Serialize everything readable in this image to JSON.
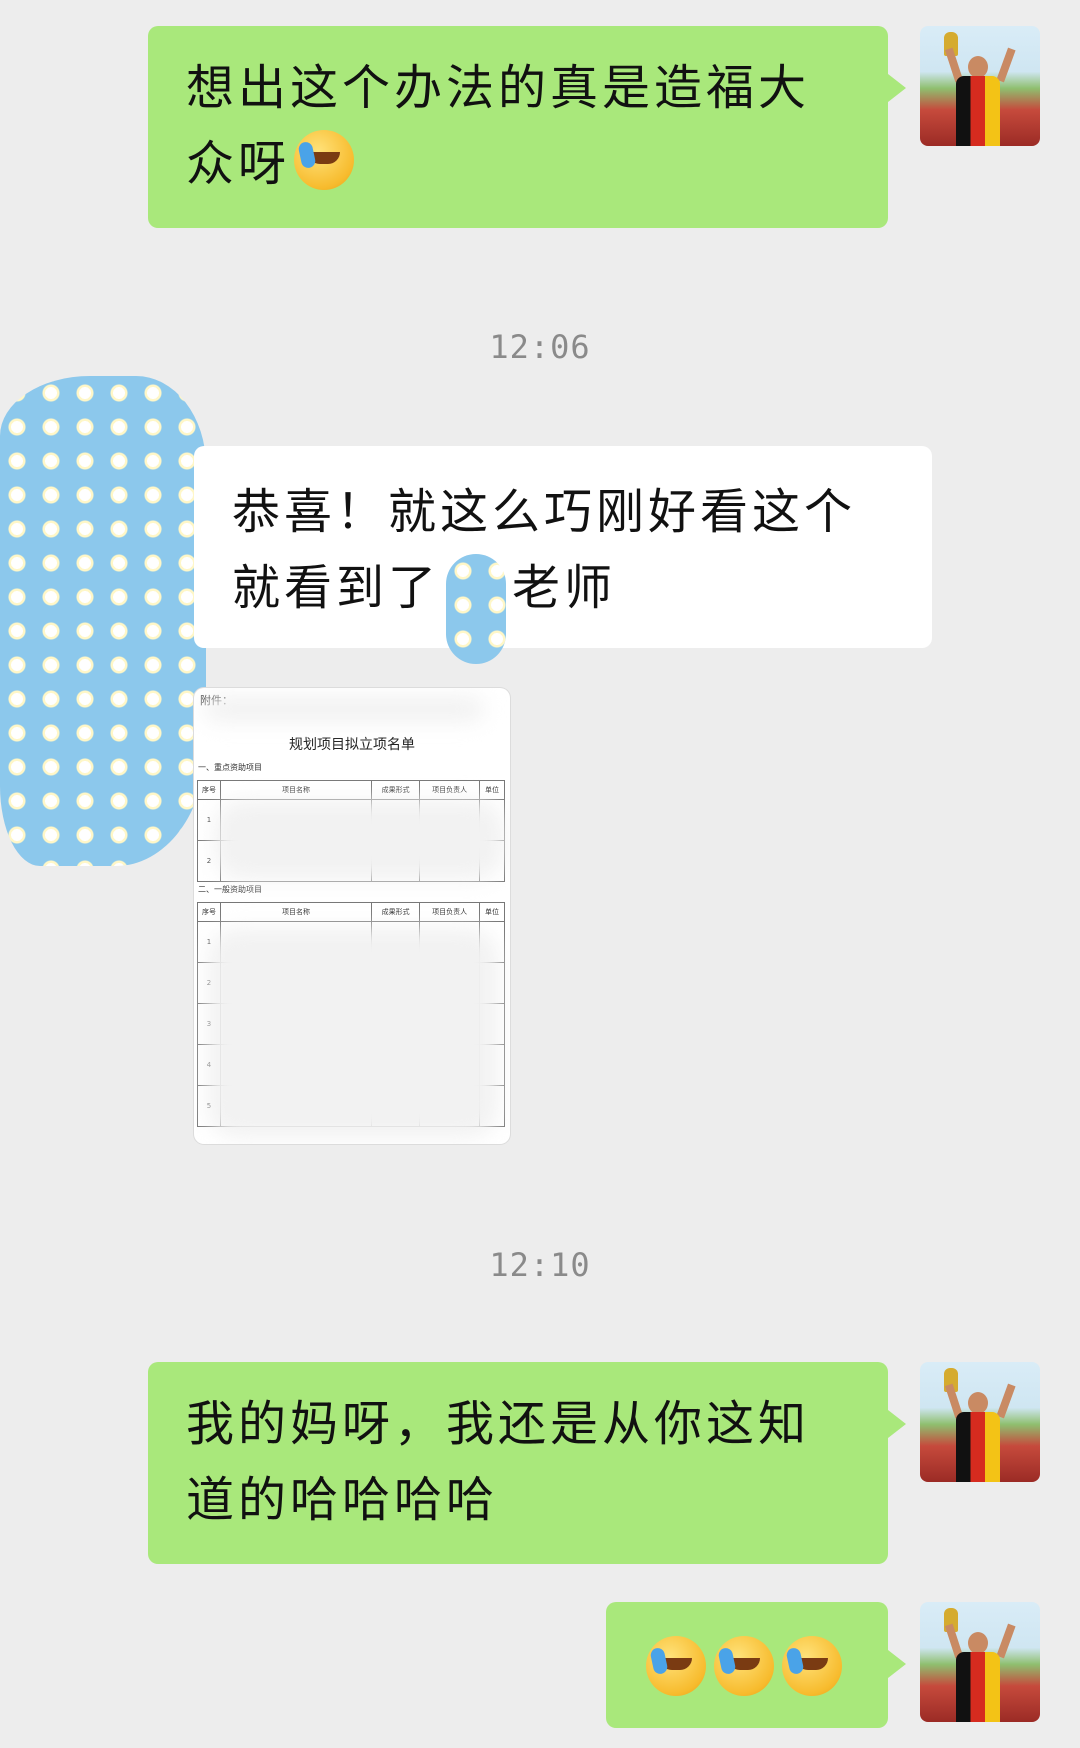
{
  "messages": {
    "m1": {
      "text": "想出这个办法的真是造福大众呀",
      "emoji": "face-with-tears-of-joy"
    },
    "m2": {
      "text": "恭喜！就这么巧刚好看这个就看到了",
      "suffix": "老师"
    },
    "m3": {
      "text": "我的妈呀，我还是从你这知道的哈哈哈哈"
    },
    "m4": {
      "emoji": [
        "face-with-tears-of-joy",
        "face-with-tears-of-joy",
        "face-with-tears-of-joy"
      ]
    }
  },
  "timestamps": {
    "t1": "12:06",
    "t2": "12:10"
  },
  "document": {
    "attach_label": "附件：",
    "title": "规划项目拟立项名单",
    "section1": "一、重点资助项目",
    "section2": "二、一般资助项目",
    "headers": [
      "序号",
      "项目名称",
      "成果形式",
      "项目负责人",
      "单位"
    ],
    "rows1": [
      "1",
      "2"
    ],
    "rows2": [
      "1",
      "2",
      "3",
      "4",
      "5"
    ]
  },
  "colors": {
    "outgoing": "#a9e87b",
    "incoming": "#ffffff",
    "background": "#ededed"
  }
}
